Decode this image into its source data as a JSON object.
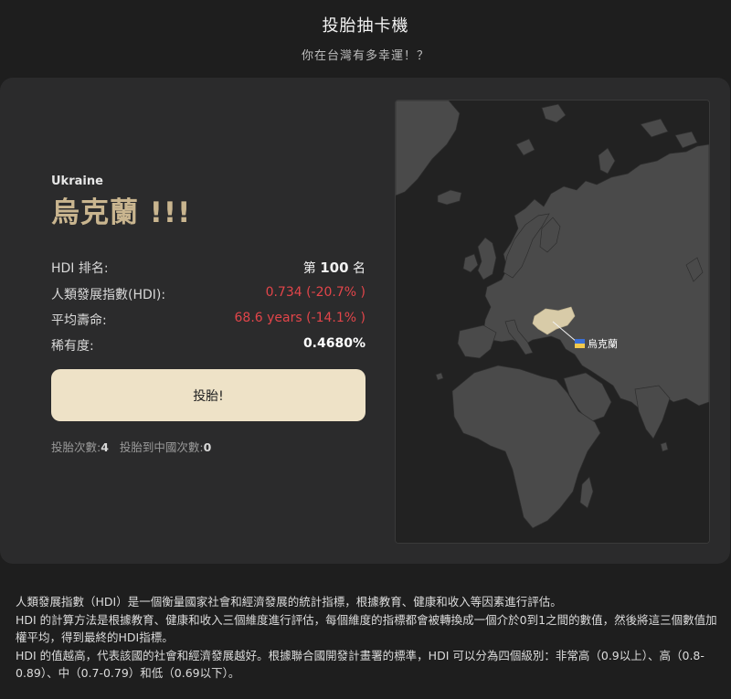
{
  "header": {
    "title": "投胎抽卡機",
    "subtitle": "你在台灣有多幸運！？"
  },
  "result": {
    "country_en": "Ukraine",
    "country_zh": "烏克蘭 !!!",
    "stats": {
      "rank_label": "HDI 排名:",
      "rank_prefix": "第",
      "rank_value": "100",
      "rank_suffix": "名",
      "hdi_label": "人類發展指數(HDI):",
      "hdi_value": "0.734 (-20.7% )",
      "life_label": "平均壽命:",
      "life_value": "68.6 years (-14.1% )",
      "rarity_label": "稀有度:",
      "rarity_value": "0.4680%"
    },
    "spin_button_label": "投胎!",
    "counts": {
      "spin_label": "投胎次數:",
      "spin_count": "4",
      "china_label": "投胎到中國次數:",
      "china_count": "0"
    }
  },
  "map": {
    "marker_label": "烏克蘭",
    "marker_flag_colors": [
      "#3b6fd6",
      "#f2c94c"
    ],
    "land_color": "#4a4a4a",
    "highlight_color": "#d8cba8",
    "ocean_color": "#222222"
  },
  "footer": {
    "p1": "人類發展指數（HDI）是一個衡量國家社會和經濟發展的統計指標，根據教育、健康和收入等因素進行評估。",
    "p2": "HDI 的計算方法是根據教育、健康和收入三個維度進行評估，每個維度的指標都會被轉換成一個介於0到1之間的數值，然後將這三個數值加權平均，得到最終的HDI指標。",
    "p3": "HDI 的值越高，代表該國的社會和經濟發展越好。根據聯合國開發計畫署的標準，HDI 可以分為四個級別：非常高（0.9以上）、高（0.8-0.89）、中（0.7-0.79）和低（0.69以下）。"
  }
}
